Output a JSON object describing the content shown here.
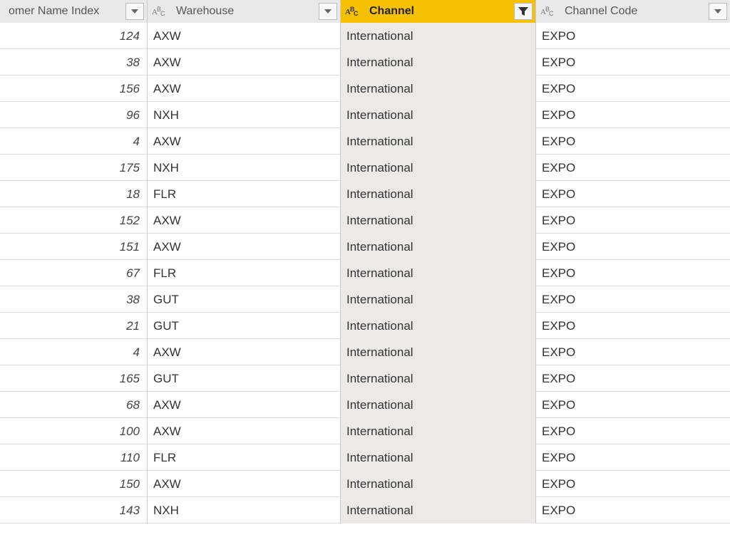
{
  "columns": {
    "customer_name_index": {
      "label": "omer Name Index",
      "type_icon": "num",
      "filtered": false,
      "selected": false
    },
    "warehouse": {
      "label": "Warehouse",
      "type_icon": "abc",
      "filtered": false,
      "selected": false
    },
    "channel": {
      "label": "Channel",
      "type_icon": "abc",
      "filtered": true,
      "selected": true
    },
    "channel_code": {
      "label": "Channel Code",
      "type_icon": "abc",
      "filtered": false,
      "selected": false
    }
  },
  "rows": [
    {
      "index": "124",
      "warehouse": "AXW",
      "channel": "International",
      "channel_code": "EXPO"
    },
    {
      "index": "38",
      "warehouse": "AXW",
      "channel": "International",
      "channel_code": "EXPO"
    },
    {
      "index": "156",
      "warehouse": "AXW",
      "channel": "International",
      "channel_code": "EXPO"
    },
    {
      "index": "96",
      "warehouse": "NXH",
      "channel": "International",
      "channel_code": "EXPO"
    },
    {
      "index": "4",
      "warehouse": "AXW",
      "channel": "International",
      "channel_code": "EXPO"
    },
    {
      "index": "175",
      "warehouse": "NXH",
      "channel": "International",
      "channel_code": "EXPO"
    },
    {
      "index": "18",
      "warehouse": "FLR",
      "channel": "International",
      "channel_code": "EXPO"
    },
    {
      "index": "152",
      "warehouse": "AXW",
      "channel": "International",
      "channel_code": "EXPO"
    },
    {
      "index": "151",
      "warehouse": "AXW",
      "channel": "International",
      "channel_code": "EXPO"
    },
    {
      "index": "67",
      "warehouse": "FLR",
      "channel": "International",
      "channel_code": "EXPO"
    },
    {
      "index": "38",
      "warehouse": "GUT",
      "channel": "International",
      "channel_code": "EXPO"
    },
    {
      "index": "21",
      "warehouse": "GUT",
      "channel": "International",
      "channel_code": "EXPO"
    },
    {
      "index": "4",
      "warehouse": "AXW",
      "channel": "International",
      "channel_code": "EXPO"
    },
    {
      "index": "165",
      "warehouse": "GUT",
      "channel": "International",
      "channel_code": "EXPO"
    },
    {
      "index": "68",
      "warehouse": "AXW",
      "channel": "International",
      "channel_code": "EXPO"
    },
    {
      "index": "100",
      "warehouse": "AXW",
      "channel": "International",
      "channel_code": "EXPO"
    },
    {
      "index": "110",
      "warehouse": "FLR",
      "channel": "International",
      "channel_code": "EXPO"
    },
    {
      "index": "150",
      "warehouse": "AXW",
      "channel": "International",
      "channel_code": "EXPO"
    },
    {
      "index": "143",
      "warehouse": "NXH",
      "channel": "International",
      "channel_code": "EXPO"
    }
  ],
  "colors": {
    "accent": "#00b5ad",
    "selected_header": "#f6c100"
  }
}
